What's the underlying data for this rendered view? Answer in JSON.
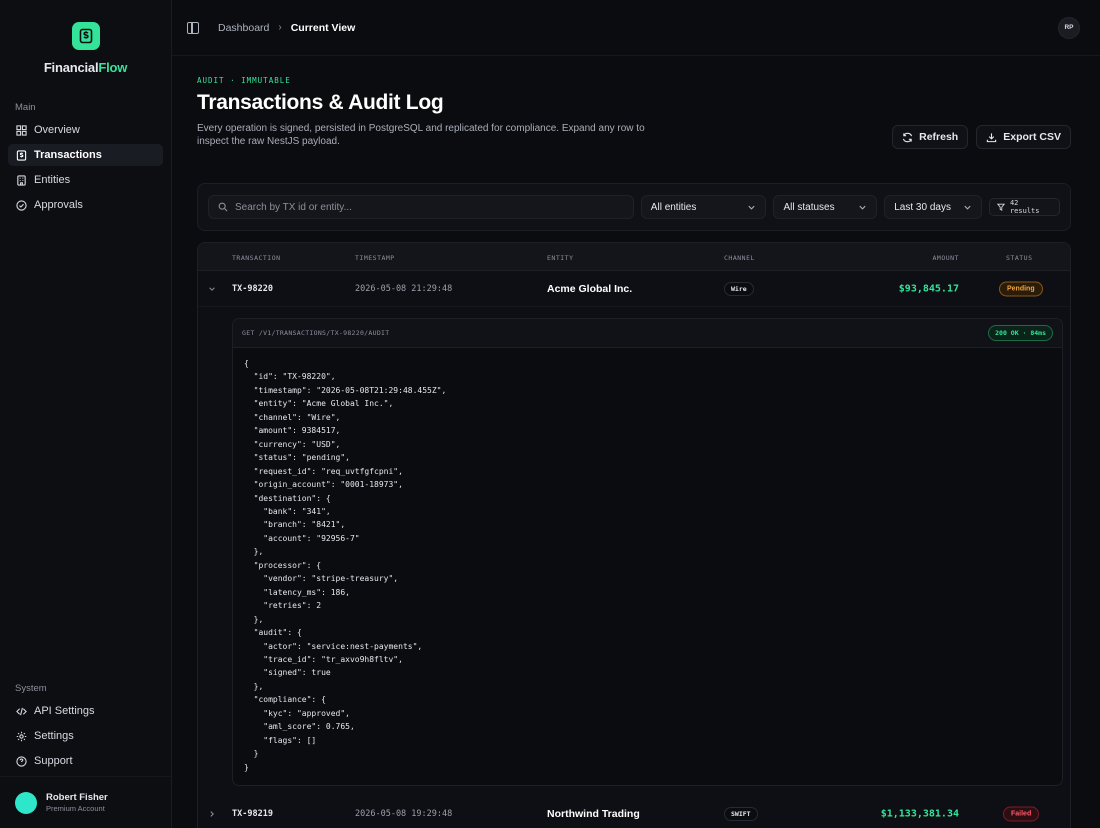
{
  "brand": {
    "name_part1": "Financial",
    "name_part2": "Flow",
    "accent": "#34e39a"
  },
  "sidebar": {
    "main_label": "Main",
    "items": [
      {
        "label": "Overview",
        "icon": "grid-icon"
      },
      {
        "label": "Transactions",
        "icon": "dollar-icon",
        "active": true
      },
      {
        "label": "Entities",
        "icon": "building-icon"
      },
      {
        "label": "Approvals",
        "icon": "check-circle-icon"
      }
    ],
    "system_label": "System",
    "system_items": [
      {
        "label": "API Settings",
        "icon": "code-icon"
      },
      {
        "label": "Settings",
        "icon": "gear-icon"
      },
      {
        "label": "Support",
        "icon": "help-circle-icon"
      }
    ],
    "user": {
      "name": "Robert Fisher",
      "plan": "Premium Account"
    }
  },
  "topbar": {
    "breadcrumb": {
      "parent": "Dashboard",
      "separator": "›",
      "current": "Current View"
    },
    "user_initials": "RP"
  },
  "header": {
    "eyebrow": "AUDIT · IMMUTABLE",
    "title": "Transactions & Audit Log",
    "subtitle": "Every operation is signed, persisted in PostgreSQL and replicated for compliance. Expand any row to inspect the raw NestJS payload.",
    "refresh_label": "Refresh",
    "export_label": "Export CSV"
  },
  "filters": {
    "search_placeholder": "Search by TX id or entity...",
    "entity_selected": "All entities",
    "status_selected": "All statuses",
    "range_selected": "Last 30 days",
    "results_count": "42 results"
  },
  "table": {
    "columns": {
      "transaction": "TRANSACTION",
      "timestamp": "TIMESTAMP",
      "entity": "ENTITY",
      "channel": "CHANNEL",
      "amount": "AMOUNT",
      "status": "STATUS"
    },
    "rows": [
      {
        "id": "TX-98220",
        "timestamp": "2026-05-08 21:29:48",
        "entity": "Acme Global Inc.",
        "channel": "Wire",
        "amount": "$93,845.17",
        "status": "Pending",
        "expanded": true
      },
      {
        "id": "TX-98219",
        "timestamp": "2026-05-08 19:29:48",
        "entity": "Northwind Trading",
        "channel": "SWIFT",
        "amount": "$1,133,381.34",
        "status": "Failed",
        "expanded": false
      }
    ],
    "detail": {
      "endpoint": "GET /V1/TRANSACTIONS/TX-98220/AUDIT",
      "response": "200 OK · 84ms",
      "payload": "{\n  \"id\": \"TX-98220\",\n  \"timestamp\": \"2026-05-08T21:29:48.455Z\",\n  \"entity\": \"Acme Global Inc.\",\n  \"channel\": \"Wire\",\n  \"amount\": 9384517,\n  \"currency\": \"USD\",\n  \"status\": \"pending\",\n  \"request_id\": \"req_uvtfgfcpni\",\n  \"origin_account\": \"0001-18973\",\n  \"destination\": {\n    \"bank\": \"341\",\n    \"branch\": \"8421\",\n    \"account\": \"92956-7\"\n  },\n  \"processor\": {\n    \"vendor\": \"stripe-treasury\",\n    \"latency_ms\": 186,\n    \"retries\": 2\n  },\n  \"audit\": {\n    \"actor\": \"service:nest-payments\",\n    \"trace_id\": \"tr_axvo9h8fltv\",\n    \"signed\": true\n  },\n  \"compliance\": {\n    \"kyc\": \"approved\",\n    \"aml_score\": 0.765,\n    \"flags\": []\n  }\n}"
    }
  },
  "colors": {
    "pending": "#f3a33d",
    "failed": "#ff5a6c",
    "amount": "#34e39a",
    "avatar": "#2ee6c9"
  }
}
